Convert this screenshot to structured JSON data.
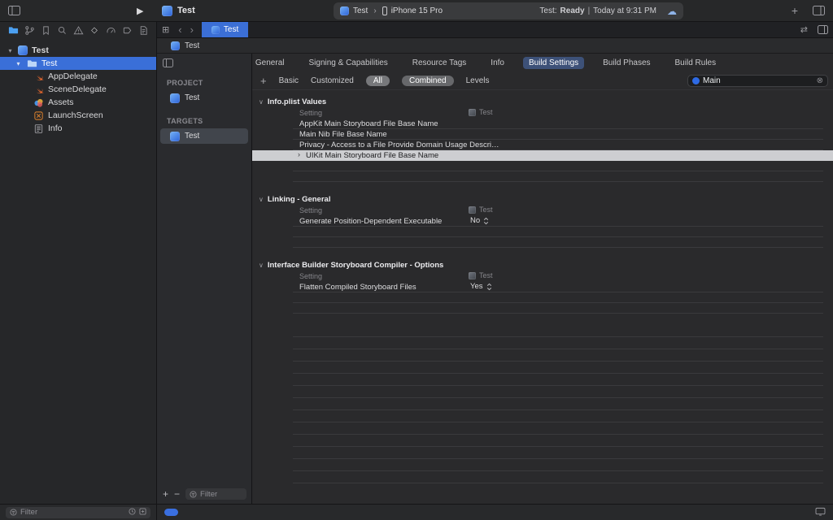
{
  "colors": {
    "accent_blue": "#3b6fd6",
    "selected_row_bg": "#cdced1",
    "active_tab_pill": "#3d5178"
  },
  "icons": {
    "navigator_bar": [
      "project-navigator-icon",
      "source-control-icon",
      "bookmark-icon",
      "search-icon",
      "issues-icon",
      "tests-icon",
      "gauge-icon",
      "breakpoint-icon",
      "reports-icon"
    ]
  },
  "toolbar": {
    "title": "Test",
    "scheme_app": "Test",
    "scheme_separator": "›",
    "scheme_device": "iPhone 15 Pro",
    "status_project": "Test:",
    "status_state": "Ready",
    "status_divider": "|",
    "status_time": "Today at 9:31 PM",
    "add_label": "+"
  },
  "tabbar": {
    "tab_label": "Test"
  },
  "jumpbar": {
    "crumb": "Test"
  },
  "navigator": {
    "root": {
      "label": "Test"
    },
    "group": {
      "label": "Test"
    },
    "files": [
      {
        "label": "AppDelegate",
        "icon": "swift-file-icon"
      },
      {
        "label": "SceneDelegate",
        "icon": "swift-file-icon"
      },
      {
        "label": "Assets",
        "icon": "asset-catalog-icon"
      },
      {
        "label": "LaunchScreen",
        "icon": "storyboard-icon"
      },
      {
        "label": "Info",
        "icon": "plist-icon"
      }
    ],
    "filter_placeholder": "Filter"
  },
  "projpane": {
    "project_header": "PROJECT",
    "project_row": "Test",
    "targets_header": "TARGETS",
    "target_row": "Test",
    "filter_placeholder": "Filter",
    "add_label": "+",
    "remove_label": "−"
  },
  "editor": {
    "tabs": [
      "General",
      "Signing & Capabilities",
      "Resource Tags",
      "Info",
      "Build Settings",
      "Build Phases",
      "Build Rules"
    ],
    "active_tab": "Build Settings",
    "scopebar": {
      "add": "+",
      "basic": "Basic",
      "customized": "Customized",
      "all": "All",
      "combined": "Combined",
      "levels": "Levels",
      "search_value": "Main",
      "clear": "⊗"
    },
    "columns": {
      "setting": "Setting",
      "target": "Test"
    },
    "sections": [
      {
        "title": "Info.plist Values",
        "rows": [
          {
            "name": "AppKit Main Storyboard File Base Name",
            "value": ""
          },
          {
            "name": "Main Nib File Base Name",
            "value": ""
          },
          {
            "name": "Privacy - Access to a File Provide Domain Usage Descri…",
            "value": ""
          },
          {
            "name": "UIKit Main Storyboard File Base Name",
            "value": "",
            "selected": true
          }
        ]
      },
      {
        "title": "Linking - General",
        "rows": [
          {
            "name": "Generate Position-Dependent Executable",
            "value": "No",
            "popup": true
          }
        ]
      },
      {
        "title": "Interface Builder Storyboard Compiler - Options",
        "rows": [
          {
            "name": "Flatten Compiled Storyboard Files",
            "value": "Yes",
            "popup": true
          }
        ]
      }
    ]
  }
}
